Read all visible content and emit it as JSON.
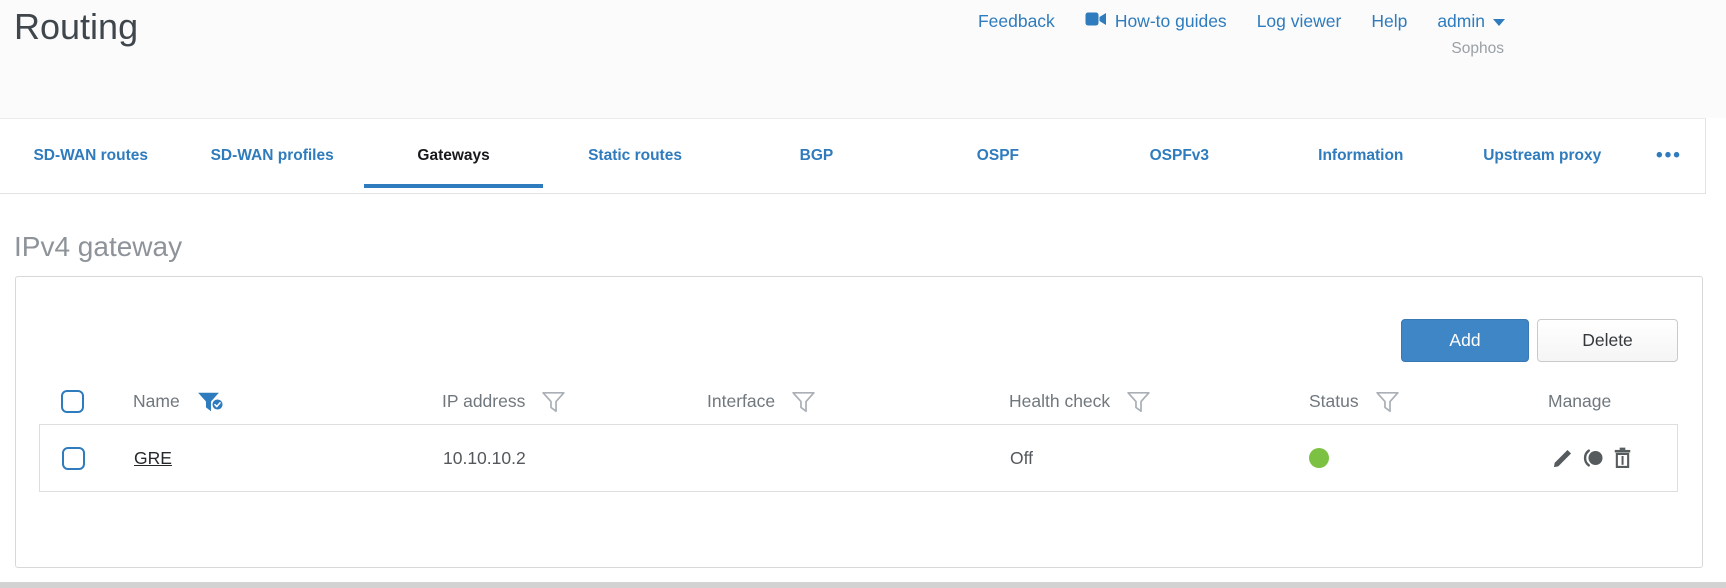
{
  "page": {
    "title": "Routing",
    "brand": "Sophos"
  },
  "topnav": {
    "feedback": "Feedback",
    "howto_guides": "How-to guides",
    "log_viewer": "Log viewer",
    "help": "Help",
    "user": "admin"
  },
  "tabs": [
    {
      "label": "SD-WAN routes",
      "active": false
    },
    {
      "label": "SD-WAN profiles",
      "active": false
    },
    {
      "label": "Gateways",
      "active": true
    },
    {
      "label": "Static routes",
      "active": false
    },
    {
      "label": "BGP",
      "active": false
    },
    {
      "label": "OSPF",
      "active": false
    },
    {
      "label": "OSPFv3",
      "active": false
    },
    {
      "label": "Information",
      "active": false
    },
    {
      "label": "Upstream proxy",
      "active": false
    }
  ],
  "tabs_overflow": "•••",
  "section": {
    "heading": "IPv4 gateway"
  },
  "toolbar": {
    "add": "Add",
    "delete": "Delete"
  },
  "table": {
    "columns": [
      {
        "label": "Name",
        "filter": "active"
      },
      {
        "label": "IP address",
        "filter": "default"
      },
      {
        "label": "Interface",
        "filter": "default"
      },
      {
        "label": "Health check",
        "filter": "default"
      },
      {
        "label": "Status",
        "filter": "default"
      },
      {
        "label": "Manage",
        "filter": "none"
      }
    ],
    "rows": [
      {
        "name": "GRE",
        "ip_address": "10.10.10.2",
        "interface": "",
        "health_check": "Off",
        "status": "up"
      }
    ]
  },
  "icons": {
    "topnav": "video-camera-icon",
    "filter": "funnel-filter-icon",
    "filter_active": "funnel-filter-active-icon",
    "manage": [
      "edit-pencil-icon",
      "deactivate-toggle-icon",
      "delete-trash-icon"
    ]
  },
  "colors": {
    "accent_blue": "#2e7bbd",
    "button_blue": "#3e86c6",
    "status_green": "#7cc142",
    "heading_gray": "#8d9399"
  }
}
